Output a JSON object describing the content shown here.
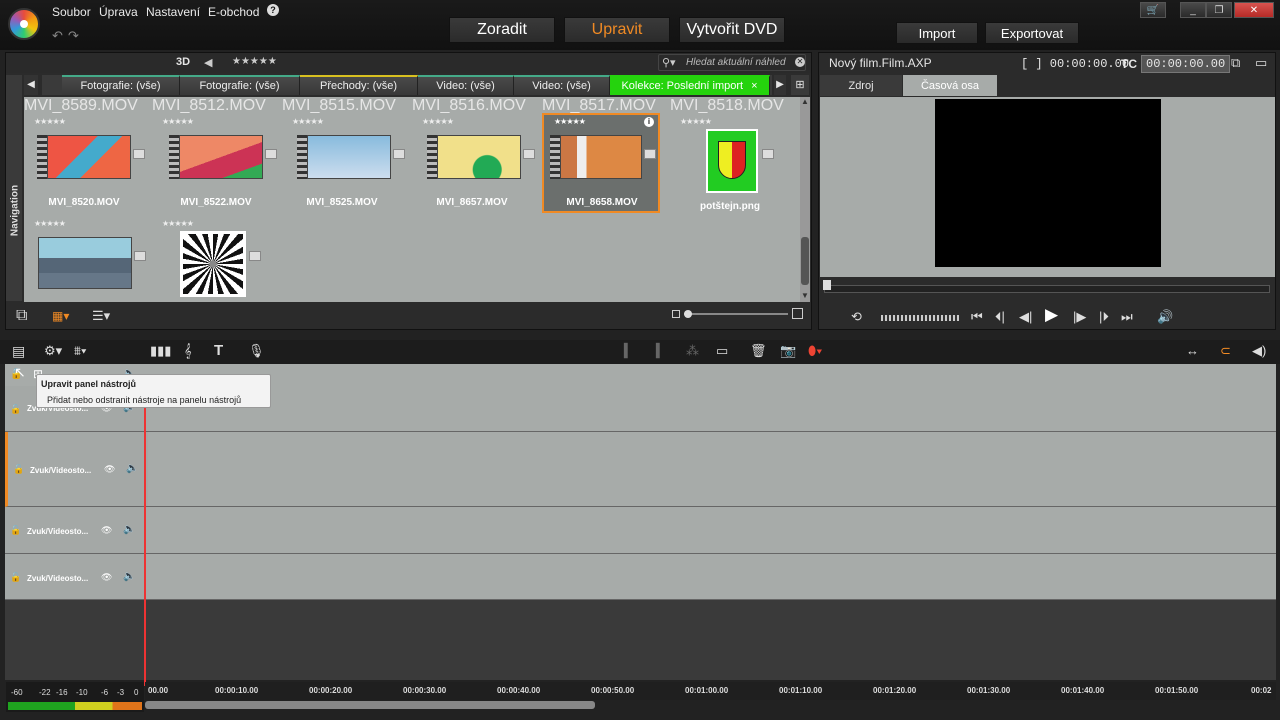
{
  "menu": [
    "Soubor",
    "Úprava",
    "Nastavení",
    "E-obchod"
  ],
  "modes": [
    "Zoradit",
    "Upravit",
    "Vytvořit DVD"
  ],
  "actions": {
    "import": "Import",
    "export": "Exportovat"
  },
  "library": {
    "threeD": "3D",
    "search_placeholder": "Hledat aktuální náhled",
    "nav_label": "Navigation",
    "tabs": [
      "Fotografie: (vše)",
      "Fotografie: (vše)",
      "Přechody: (vše)",
      "Video: (vše)",
      "Video: (vše)",
      "Kolekce: Poslední import"
    ],
    "items": [
      {
        "name": "MVI_8589.MOV",
        "row": "top"
      },
      {
        "name": "MVI_8512.MOV",
        "row": "top"
      },
      {
        "name": "MVI_8515.MOV",
        "row": "top"
      },
      {
        "name": "MVI_8516.MOV",
        "row": "top"
      },
      {
        "name": "MVI_8517.MOV",
        "row": "top"
      },
      {
        "name": "MVI_8518.MOV",
        "row": "top"
      },
      {
        "name": "MVI_8520.MOV",
        "row": "mid"
      },
      {
        "name": "MVI_8522.MOV",
        "row": "mid"
      },
      {
        "name": "MVI_8525.MOV",
        "row": "mid"
      },
      {
        "name": "MVI_8657.MOV",
        "row": "mid"
      },
      {
        "name": "MVI_8658.MOV",
        "row": "mid"
      },
      {
        "name": "potštejn.png",
        "row": "mid"
      }
    ]
  },
  "player": {
    "title": "Nový film.Film.AXP",
    "timecode_in": "[ ] 00:00:00.00",
    "tc_label": "TC",
    "tc_value": "00:00:00.00",
    "tabs": [
      "Zdroj",
      "Časová osa"
    ]
  },
  "timeline": {
    "tracks": [
      "Zvuk/Videosto...",
      "Zvuk/Videosto...",
      "Zvuk/Videosto...",
      "Zvuk/Videosto..."
    ],
    "ruler": [
      "00.00",
      "00:00:10.00",
      "00:00:20.00",
      "00:00:30.00",
      "00:00:40.00",
      "00:00:50.00",
      "00:01:00.00",
      "00:01:10.00",
      "00:01:20.00",
      "00:01:30.00",
      "00:01:40.00",
      "00:01:50.00",
      "00:02"
    ],
    "db": [
      "-60",
      "-22",
      "-16",
      "-10",
      "-6",
      "-3",
      "0"
    ]
  },
  "tooltip": {
    "title": "Upravit panel nástrojů",
    "body": "Přidat nebo odstranit nástroje na panelu nástrojů"
  }
}
